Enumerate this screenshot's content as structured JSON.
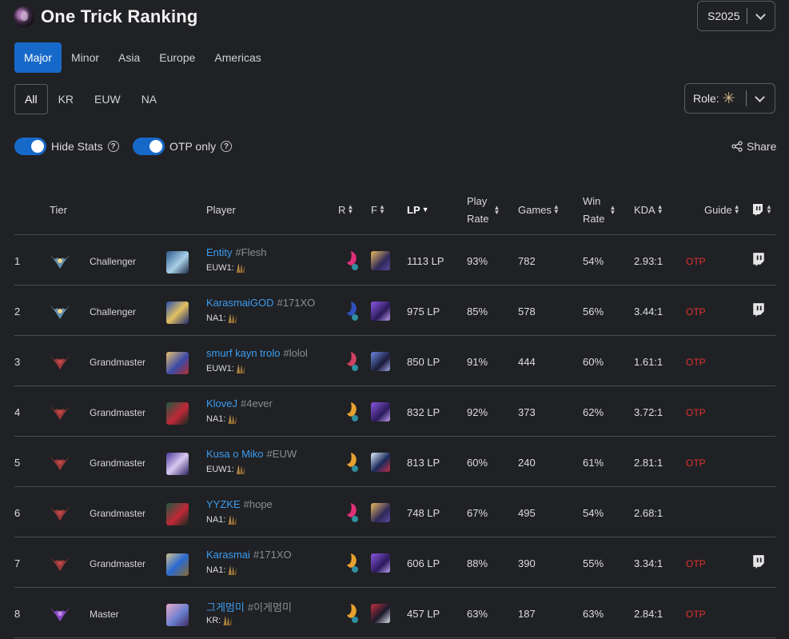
{
  "header": {
    "title": "One Trick Ranking",
    "season": "S2025"
  },
  "region_tabs": [
    "Major",
    "Minor",
    "Asia",
    "Europe",
    "Americas"
  ],
  "server_tabs": [
    "All",
    "KR",
    "EUW",
    "NA"
  ],
  "role_filter": {
    "label": "Role:"
  },
  "toggles": [
    {
      "label": "Hide Stats",
      "on": true
    },
    {
      "label": "OTP only",
      "on": true
    }
  ],
  "share_label": "Share",
  "columns": {
    "tier": "Tier",
    "player": "Player",
    "runes": "R",
    "spells": "F",
    "lp": "LP",
    "play_rate_1": "Play",
    "play_rate_2": "Rate",
    "games": "Games",
    "win_rate_1": "Win",
    "win_rate_2": "Rate",
    "kda": "KDA",
    "guide": "Guide"
  },
  "colors": {
    "accent": "#1769c9",
    "link": "#3b9cf0",
    "otp": "#e03232"
  },
  "rows": [
    {
      "rank": "1",
      "tier": "Challenger",
      "name": "Entity",
      "tag": "#Flesh",
      "server": "EUW1:",
      "lp": "1113 LP",
      "play_rate": "93%",
      "games": "782",
      "win_rate": "54%",
      "kda": "2.93:1",
      "otp": "OTP",
      "twitch": true
    },
    {
      "rank": "2",
      "tier": "Challenger",
      "name": "KarasmaiGOD",
      "tag": "#171XO",
      "server": "NA1:",
      "lp": "975 LP",
      "play_rate": "85%",
      "games": "578",
      "win_rate": "56%",
      "kda": "3.44:1",
      "otp": "OTP",
      "twitch": true
    },
    {
      "rank": "3",
      "tier": "Grandmaster",
      "name": "smurf kayn trolo",
      "tag": "#lolol",
      "server": "EUW1:",
      "lp": "850 LP",
      "play_rate": "91%",
      "games": "444",
      "win_rate": "60%",
      "kda": "1.61:1",
      "otp": "OTP",
      "twitch": false
    },
    {
      "rank": "4",
      "tier": "Grandmaster",
      "name": "KloveJ",
      "tag": "#4ever",
      "server": "NA1:",
      "lp": "832 LP",
      "play_rate": "92%",
      "games": "373",
      "win_rate": "62%",
      "kda": "3.72:1",
      "otp": "OTP",
      "twitch": false
    },
    {
      "rank": "5",
      "tier": "Grandmaster",
      "name": "Kusa o Miko",
      "tag": "#EUW",
      "server": "EUW1:",
      "lp": "813 LP",
      "play_rate": "60%",
      "games": "240",
      "win_rate": "61%",
      "kda": "2.81:1",
      "otp": "OTP",
      "twitch": false
    },
    {
      "rank": "6",
      "tier": "Grandmaster",
      "name": "YYZKE",
      "tag": "#hope",
      "server": "NA1:",
      "lp": "748 LP",
      "play_rate": "67%",
      "games": "495",
      "win_rate": "54%",
      "kda": "2.68:1",
      "otp": "",
      "twitch": false
    },
    {
      "rank": "7",
      "tier": "Grandmaster",
      "name": "Karasmai",
      "tag": "#171XO",
      "server": "NA1:",
      "lp": "606 LP",
      "play_rate": "88%",
      "games": "390",
      "win_rate": "55%",
      "kda": "3.34:1",
      "otp": "OTP",
      "twitch": true
    },
    {
      "rank": "8",
      "tier": "Master",
      "name": "그게멈미",
      "tag": "#이게멈미",
      "server": "KR:",
      "lp": "457 LP",
      "play_rate": "63%",
      "games": "187",
      "win_rate": "63%",
      "kda": "2.84:1",
      "otp": "OTP",
      "twitch": false
    }
  ]
}
